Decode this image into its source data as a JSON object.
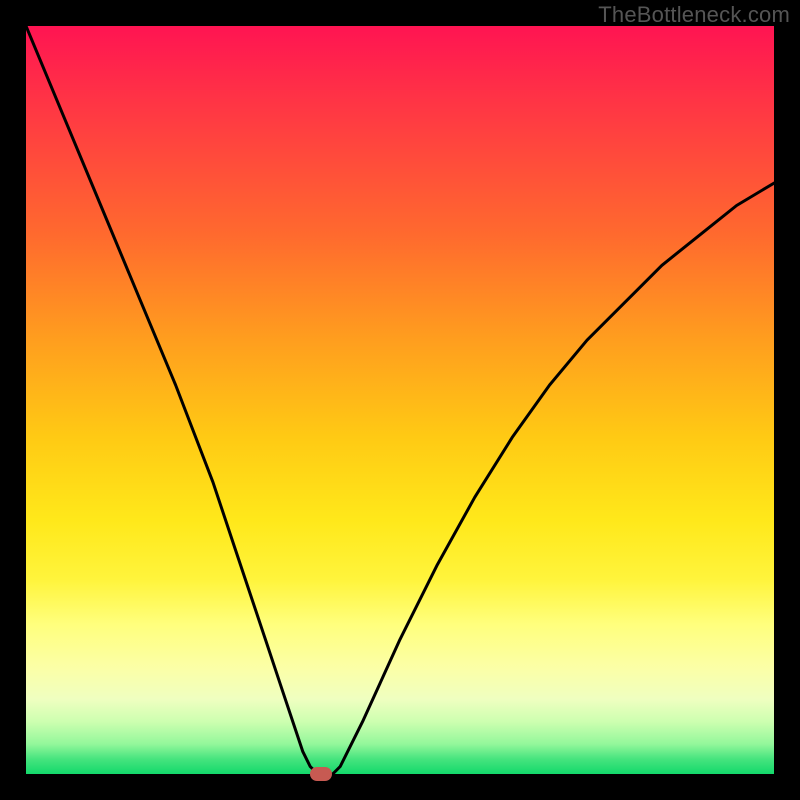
{
  "watermark": "TheBottleneck.com",
  "chart_data": {
    "type": "line",
    "title": "",
    "xlabel": "",
    "ylabel": "",
    "xlim": [
      0,
      100
    ],
    "ylim": [
      0,
      100
    ],
    "x": [
      0,
      5,
      10,
      15,
      20,
      25,
      28,
      30,
      32,
      34,
      36,
      37,
      38,
      39,
      40,
      41,
      42,
      45,
      50,
      55,
      60,
      65,
      70,
      75,
      80,
      85,
      90,
      95,
      100
    ],
    "y": [
      100,
      88,
      76,
      64,
      52,
      39,
      30,
      24,
      18,
      12,
      6,
      3,
      1,
      0,
      0,
      0,
      1,
      7,
      18,
      28,
      37,
      45,
      52,
      58,
      63,
      68,
      72,
      76,
      79
    ],
    "marker": {
      "x": 39.5,
      "y": 0
    },
    "colors": {
      "curve": "#000000",
      "marker": "#c75a52",
      "gradient_top": "#ff1452",
      "gradient_bottom": "#13d96b"
    }
  }
}
